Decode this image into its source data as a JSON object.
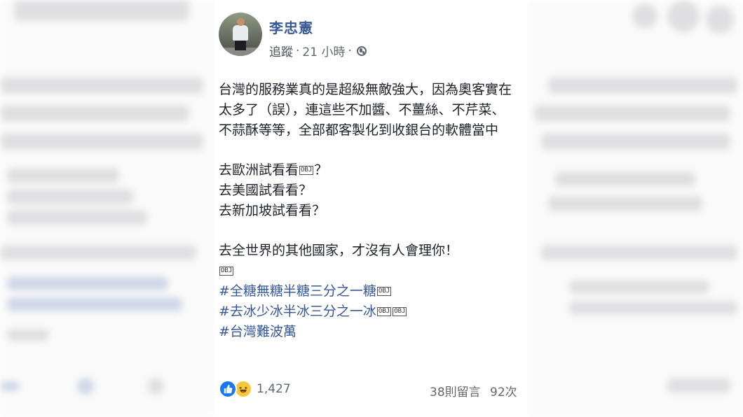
{
  "post": {
    "author": "李忠憲",
    "follow_label": "追蹤",
    "time": "21 小時",
    "body_lines": [
      "台灣的服務業真的是超級無敵強大，因為奧客實在",
      "太多了（誤），連這些不加醬、不薑絲、不芹菜、",
      "不蒜酥等等，全部都客製化到收銀台的軟體當中"
    ],
    "questions": [
      "去歐洲試看看",
      "？",
      "去美國試看看？",
      "去新加坡試看看？"
    ],
    "closing": "去全世界的其他國家，才沒有人會理你！",
    "obj_glyph": "OBJ",
    "hashtags": [
      "#全糖無糖半糖三分之一糖",
      "#去冰少冰半冰三分之一冰",
      "#台灣難波萬"
    ]
  },
  "footer": {
    "reaction_count": "1,427",
    "comments": "38則留言",
    "shares": "92次"
  },
  "colors": {
    "link": "#385898",
    "hashtag": "#365899",
    "text": "#1d2129",
    "meta": "#606770",
    "like": "#1877f2",
    "haha": "#f7c93a"
  },
  "icons": [
    "globe-icon",
    "like-reaction-icon",
    "haha-reaction-icon"
  ]
}
